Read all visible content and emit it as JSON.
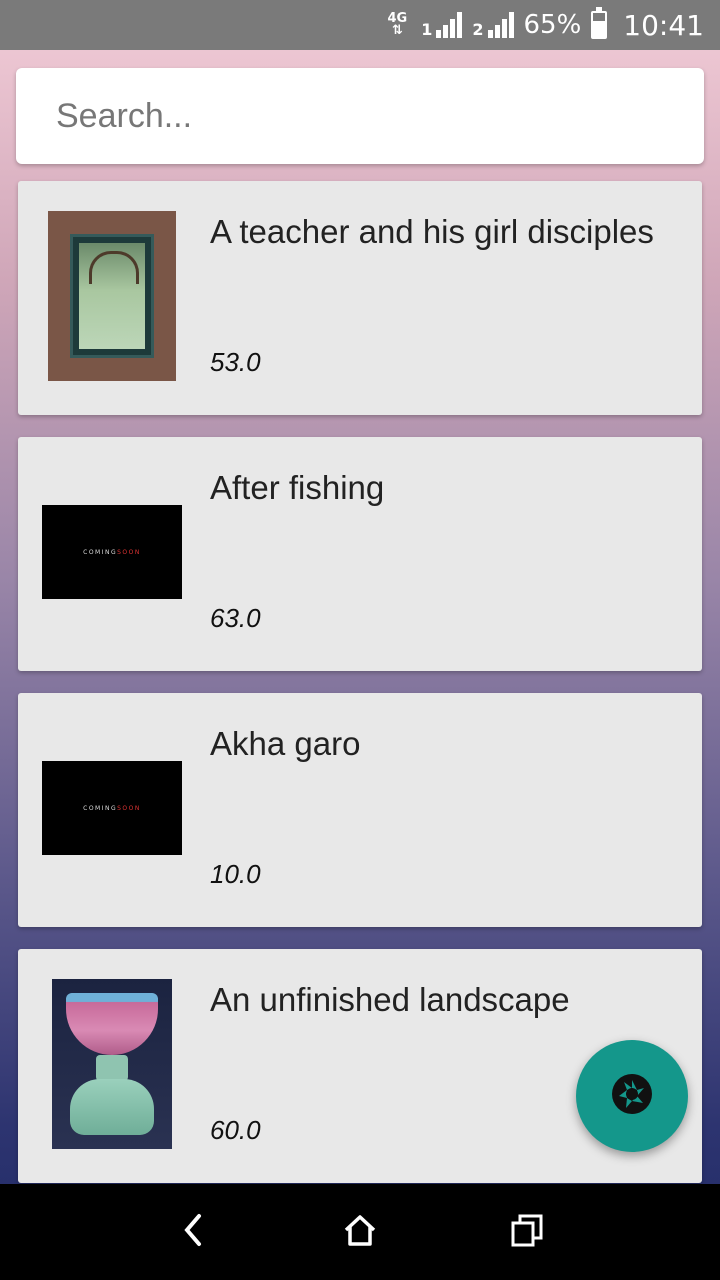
{
  "status_bar": {
    "network": "4G",
    "sim1": "1",
    "sim2": "2",
    "battery_pct": "65%",
    "battery_level": 0.65,
    "time": "10:41"
  },
  "search": {
    "placeholder": "Search...",
    "value": ""
  },
  "thumbnail_text": {
    "coming": "COMING",
    "soon": "SOON"
  },
  "items": [
    {
      "title": "A teacher and his girl disciples",
      "price": "53.0",
      "image": "miniature-painting"
    },
    {
      "title": "After fishing",
      "price": "63.0",
      "image": "coming-soon"
    },
    {
      "title": "Akha garo",
      "price": "10.0",
      "image": "coming-soon"
    },
    {
      "title": "An unfinished landscape",
      "price": "60.0",
      "image": "lotus-cup"
    }
  ],
  "fab": {
    "icon": "camera-shutter-icon"
  },
  "nav_bar": {
    "icons": [
      "back-icon",
      "home-icon",
      "recents-icon"
    ]
  },
  "colors": {
    "fab": "#14978b",
    "card": "#e8e8e8",
    "status_bar": "#7a7a7a"
  }
}
